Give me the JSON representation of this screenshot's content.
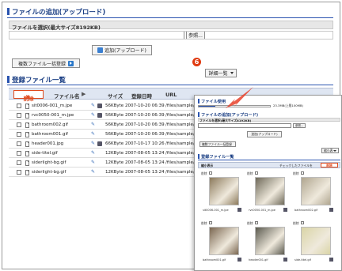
{
  "upload": {
    "title": "ファイルの追加(アップロード)",
    "label": "ファイルを選択(最大サイズ8192KB)",
    "browse": "参照...",
    "submit": "追加(アップロード)",
    "bulk": "複数ファイル一括登録"
  },
  "list": {
    "title": "登録ファイル一覧",
    "delete": "削除",
    "view_select": "詳細一覧",
    "step_badge": "6",
    "columns": {
      "name": "ファイル名",
      "size": "サイズ",
      "date": "登録日時",
      "url": "URL"
    },
    "rows": [
      {
        "name": "sit0006-001_m.jpe",
        "size": "56KByte",
        "date": "2007-10-20 06:39",
        "url": "/files/sample/s"
      },
      {
        "name": "rvc0050-001_m.jpe",
        "size": "56KByte",
        "date": "2007-10-20 06:39",
        "url": "/files/sample/r"
      },
      {
        "name": "bathroom002.gif",
        "size": "56KByte",
        "date": "2007-10-20 06:39",
        "url": "/files/sample/b"
      },
      {
        "name": "bathroom001.gif",
        "size": "56KByte",
        "date": "2007-10-20 06:39",
        "url": "/files/sample/b"
      },
      {
        "name": "header001.jpg",
        "size": "66KByte",
        "date": "2007-10-17 10:26",
        "url": "/files/sample/h"
      },
      {
        "name": "side-titel.gif",
        "size": "12KByte",
        "date": "2007-08-05 13:24",
        "url": "/files/sample/s"
      },
      {
        "name": "siderlight-bg.gif",
        "size": "12KByte",
        "date": "2007-08-05 13:24",
        "url": "/files/sample/s"
      },
      {
        "name": "siderlight-bg.gif",
        "size": "12KByte",
        "date": "2007-08-05 13:24",
        "url": "/files/sample/s"
      }
    ]
  },
  "overlay": {
    "usage_title": "ファイル使用",
    "usage_text": "23.3MB(上限100MB)",
    "upload_title": "ファイルの追加(アップロード)",
    "label": "ファイルを選択(最大サイズ8192KB)",
    "browse": "参照...",
    "submit": "追加(アップロード)",
    "bulk": "複数ファイル一括登録",
    "list_title": "登録ファイル一覧",
    "view_select": "縮小表",
    "count_label": "縮小表示",
    "check_all": "チェックしたファイルを",
    "delete": "削除",
    "del_label": "削除",
    "thumbs": [
      {
        "caption": "sit0006-001_m.jpe",
        "color": "#8c7a5c"
      },
      {
        "caption": "rvc0050-001_m.jpe",
        "color": "#6f6a5a"
      },
      {
        "caption": "bathroom002.gif",
        "color": "#b0a690"
      },
      {
        "caption": "bathroom001.gif",
        "color": "#7a6650"
      },
      {
        "caption": "header001.gif",
        "color": "#5b5a4f"
      },
      {
        "caption": "side-titel.gif",
        "color": "#d9d4a6"
      }
    ]
  },
  "colors": {
    "accent": "#2a54b0",
    "danger": "#e04b1e",
    "badge": "#e03a10"
  }
}
